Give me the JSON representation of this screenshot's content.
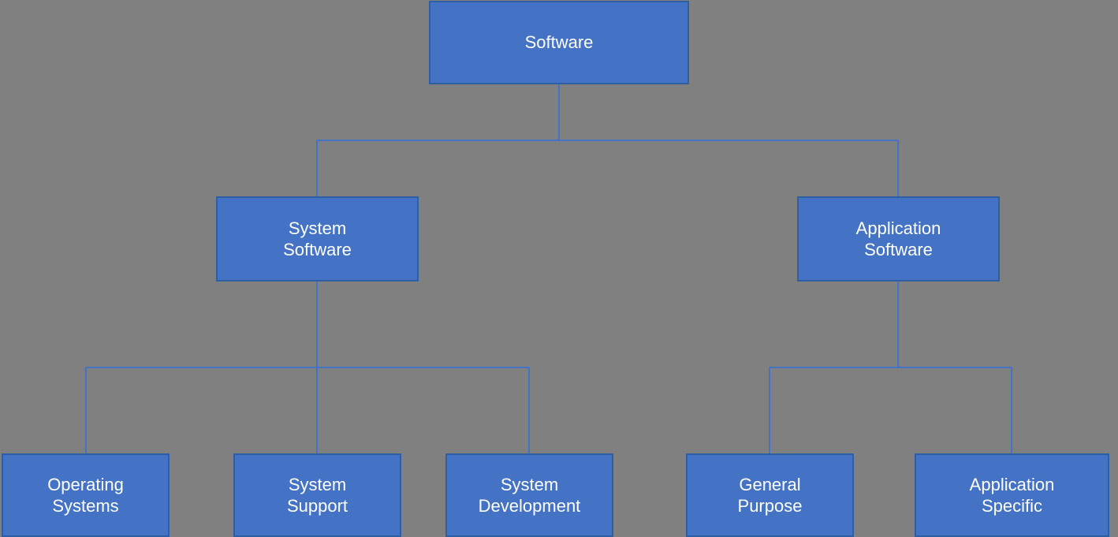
{
  "nodes": {
    "software": {
      "label": "Software"
    },
    "system_software": {
      "label": "System\nSoftware"
    },
    "application_software": {
      "label": "Application\nSoftware"
    },
    "operating_systems": {
      "label": "Operating\nSystems"
    },
    "system_support": {
      "label": "System\nSupport"
    },
    "system_development": {
      "label": "System\nDevelopment"
    },
    "general_purpose": {
      "label": "General\nPurpose"
    },
    "application_specific": {
      "label": "Application\nSpecific"
    }
  },
  "colors": {
    "box_fill": "#4472C4",
    "box_border": "#2E5FA3",
    "box_text": "#ffffff",
    "connector": "#4472C4",
    "background": "#808080"
  }
}
